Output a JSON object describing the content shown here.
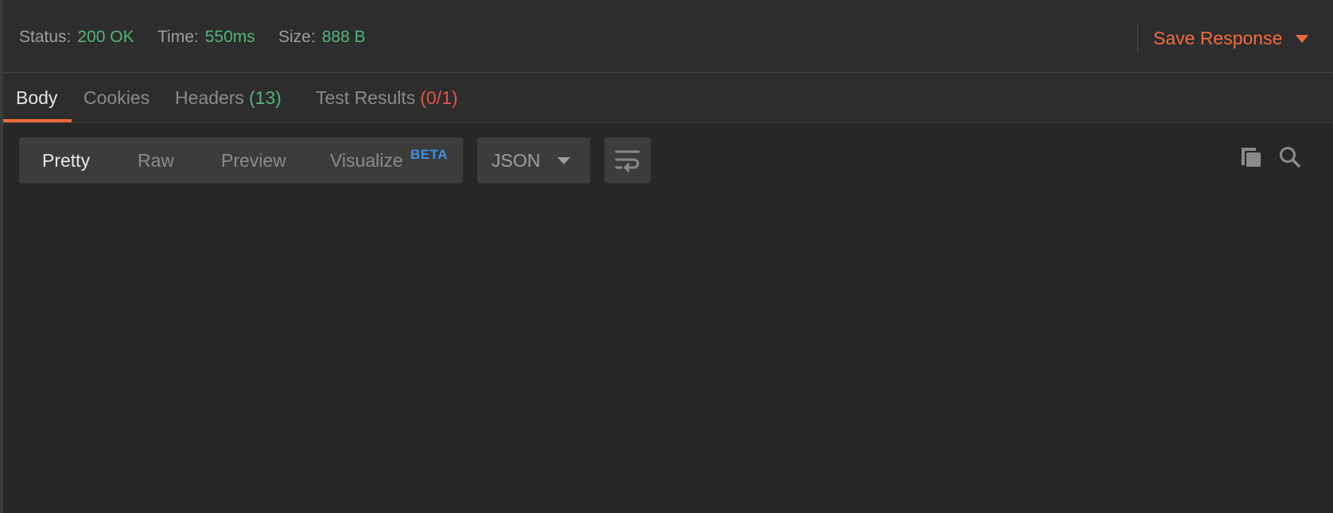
{
  "status_bar": {
    "status": {
      "label": "Status:",
      "value": "200 OK"
    },
    "time": {
      "label": "Time:",
      "value": "550ms"
    },
    "size": {
      "label": "Size:",
      "value": "888 B"
    },
    "save_response_label": "Save Response"
  },
  "tabs": [
    {
      "label": "Body",
      "count": "",
      "active": true
    },
    {
      "label": "Cookies",
      "count": "",
      "active": false
    },
    {
      "label": "Headers",
      "count": "(13)",
      "active": false
    },
    {
      "label": "Test Results",
      "count": "(0/1)",
      "active": false
    }
  ],
  "view_modes": [
    {
      "label": "Pretty",
      "active": true
    },
    {
      "label": "Raw",
      "active": false
    },
    {
      "label": "Preview",
      "active": false
    },
    {
      "label": "Visualize",
      "active": false
    }
  ],
  "visualize_badge": "BETA",
  "format_select": {
    "selected": "JSON"
  },
  "icons": {
    "wrap": "wrap-lines-icon",
    "copy": "copy-icon",
    "search": "search-icon"
  },
  "colors": {
    "accent": "#f26b3a",
    "success": "#4fb57a",
    "error": "#e0524a",
    "beta": "#3d8de4",
    "background": "#272727"
  }
}
